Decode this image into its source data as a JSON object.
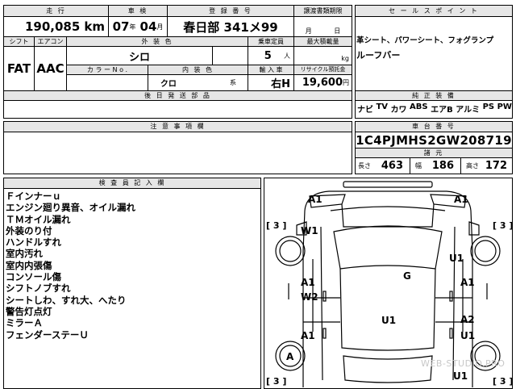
{
  "vehicle": {
    "mileage_label": "走 行",
    "mileage_value": "190,085",
    "mileage_unit": "km",
    "inspection_label": "車 検",
    "inspection_year": "07",
    "inspection_year_unit": "年",
    "inspection_month": "04",
    "inspection_month_unit": "月",
    "registration_label": "登 録 番 号",
    "registration_value": "春日部 341メ99",
    "transfer_label": "譲渡書類期限",
    "transfer_month_unit": "月",
    "transfer_day_unit": "日",
    "shift_label": "シフト",
    "shift_value": "FAT",
    "aircon_label": "エアコン",
    "aircon_value": "AAC",
    "exterior_label": "外 装 色",
    "exterior_value": "シロ",
    "color_no_label": "カ ラ ー N o .",
    "interior_label": "内 装 色",
    "interior_value": "クロ",
    "interior_unit": "系",
    "capacity_label": "乗車定員",
    "capacity_value": "5",
    "capacity_unit": "人",
    "load_label": "最大積載量",
    "load_unit": "kg",
    "import_label": "輸 入 車",
    "import_value": "右H",
    "recycle_label": "リサイクル預託金",
    "recycle_value": "19,600",
    "recycle_unit": "円",
    "rear_label": "後 日 発 送 部 品",
    "caution_label": "注 意 事 項 欄"
  },
  "sales": {
    "label": "セ ー ル ス ポ イ ン ト",
    "lines": [
      "革シート、パワーシート、フォグランプ",
      "ルーフバー"
    ]
  },
  "equipment": {
    "label": "純 正 装 備",
    "items": [
      "ナビ",
      "TV",
      "カワ",
      "ABS",
      "エアB",
      "アルミ",
      "PS",
      "PW"
    ]
  },
  "chassis": {
    "label": "車 台 番 号",
    "value": "1C4PJMHS2GW208719"
  },
  "dimensions": {
    "label": "諸 元",
    "length_label": "長さ",
    "length_value": "463",
    "width_label": "幅",
    "width_value": "186",
    "height_label": "高さ",
    "height_value": "172"
  },
  "inspector": {
    "label": "検 査 員 記 入 欄",
    "notes": [
      "Ｆインナーｕ",
      "エンジン廻り異音、オイル漏れ",
      "ＴＭオイル漏れ",
      "外装のり付",
      "ハンドルすれ",
      "室内汚れ",
      "室内内張傷",
      "コンソール傷",
      "シフトノブすれ",
      "シートしわ、すれ大、へたり",
      "警告灯点灯",
      "ミラーＡ",
      "フェンダーステーＵ"
    ]
  },
  "damage": {
    "a1_front_left": "A1",
    "a1_front_right": "A1",
    "w1": "W1",
    "u1_right_upper": "U1",
    "g": "G",
    "a1_left_mid": "A1",
    "a1_right_mid": "A1",
    "w2": "W2",
    "u1_center": "U1",
    "a2": "A2",
    "a1_left_low": "A1",
    "u1_right_low": "U1",
    "u1_bottom": "U1",
    "a_wheel": "A",
    "bracket_tl": "[ 3 ]",
    "bracket_tr": "[ 3 ]",
    "bracket_bl": "[ 3 ]",
    "bracket_br": "[ 3 ]"
  },
  "watermark": "WEB-STUDIO.PRO"
}
